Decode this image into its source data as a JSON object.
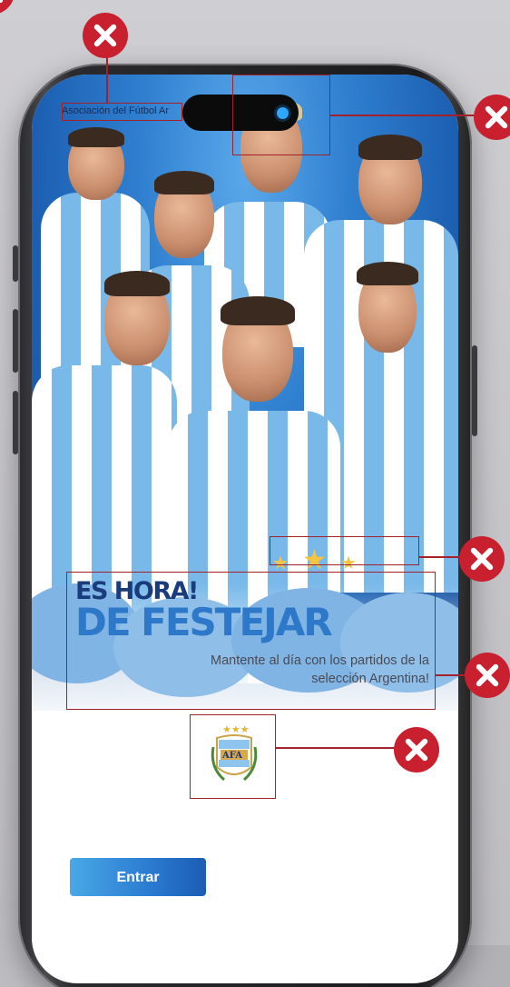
{
  "app": {
    "brand_text": "Asociación del Fútbol Ar"
  },
  "hero": {
    "headline_line1": "ES HORA!",
    "headline_line2": "DE FESTEJAR",
    "subtitle": "Mantente al día con los partidos de la selección Argentina!",
    "stars": [
      "star-icon",
      "star-icon",
      "star-icon"
    ]
  },
  "crest": {
    "text": "AFA"
  },
  "actions": {
    "enter_label": "Entrar"
  },
  "colors": {
    "primary_blue": "#2d78c8",
    "dark_blue": "#1a3c7c",
    "button_gradient_start": "#4aa8e6",
    "button_gradient_end": "#1c5cb4",
    "annotation_red": "#c8202e",
    "star_gold": "#f5c542"
  },
  "annotations": [
    {
      "name": "brand-text-marker",
      "icon": "close-icon"
    },
    {
      "name": "camera-marker",
      "icon": "close-icon"
    },
    {
      "name": "stars-marker",
      "icon": "close-icon"
    },
    {
      "name": "headline-marker",
      "icon": "close-icon"
    },
    {
      "name": "crest-marker",
      "icon": "close-icon"
    }
  ]
}
